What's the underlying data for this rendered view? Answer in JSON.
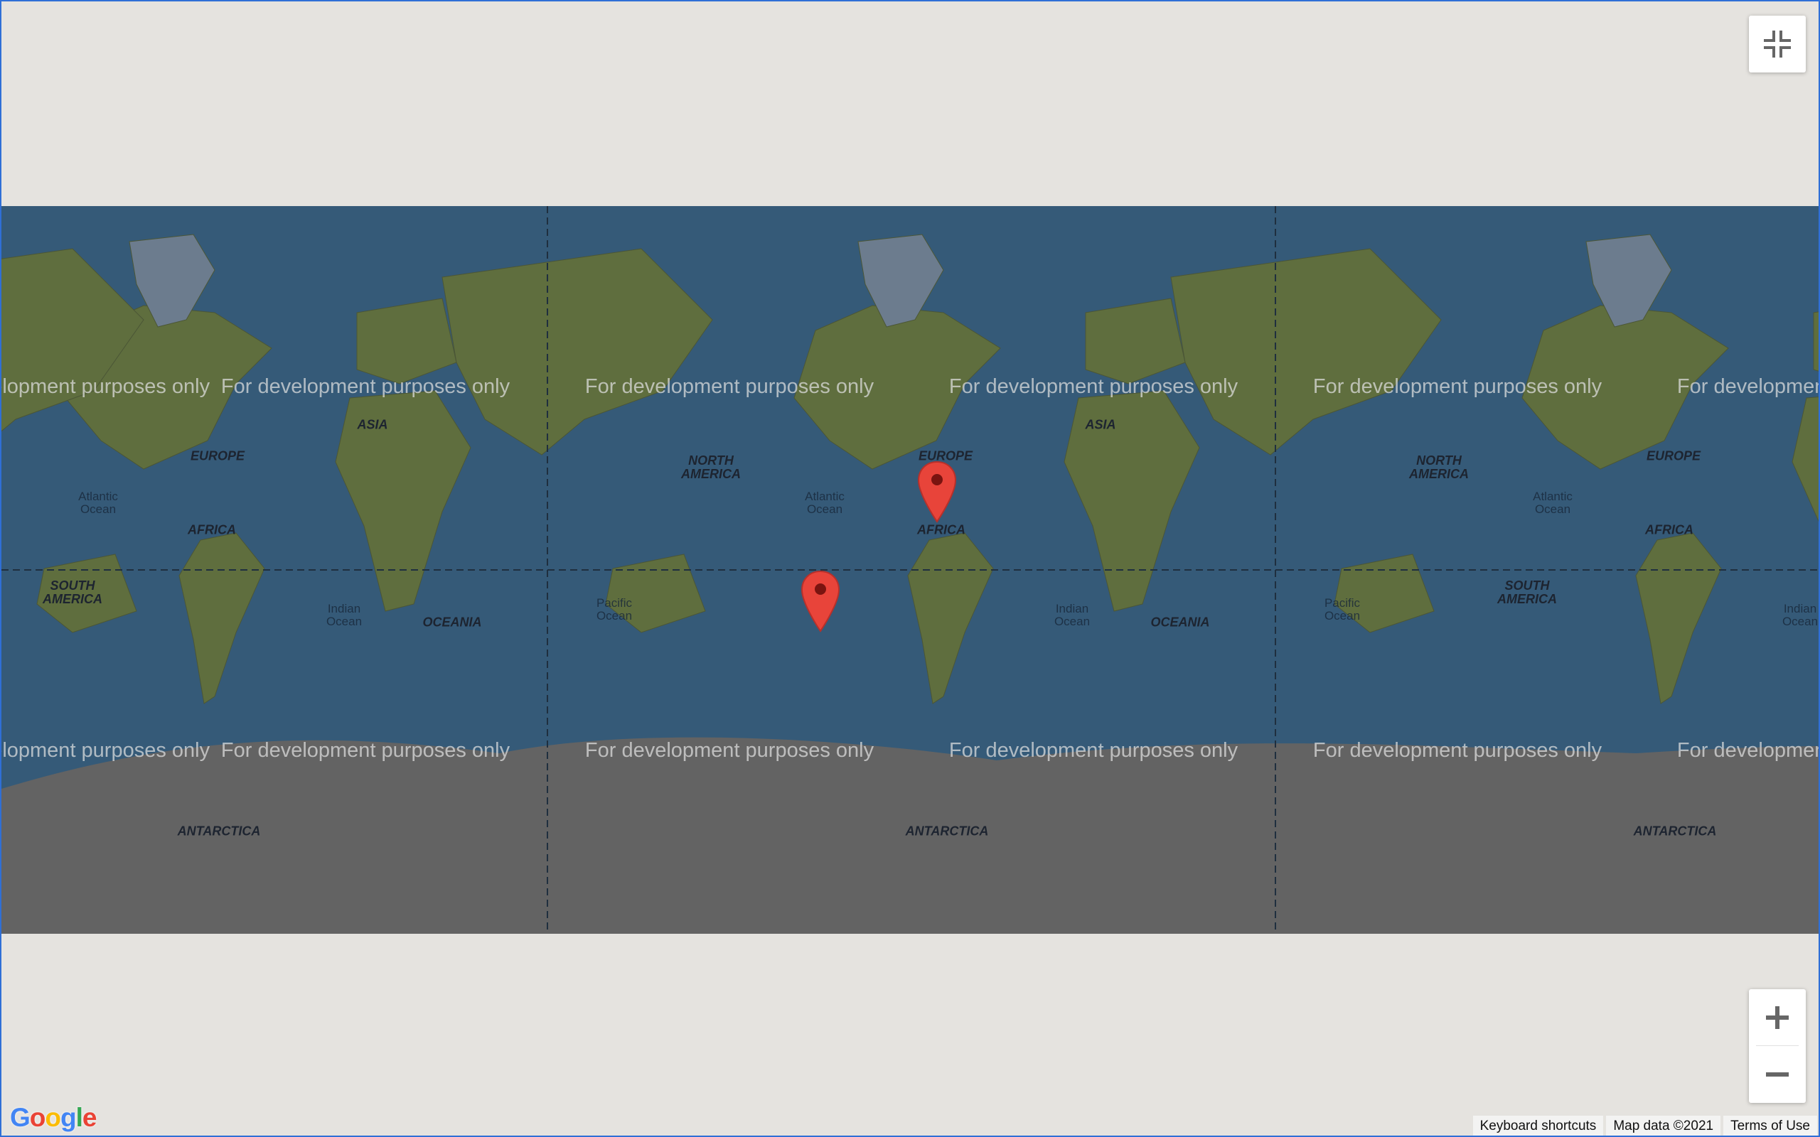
{
  "map": {
    "watermark": "For development purposes only",
    "continents": {
      "north_america": "NORTH\nAMERICA",
      "south_america": "SOUTH\nAMERICA",
      "europe": "EUROPE",
      "africa": "AFRICA",
      "asia": "ASIA",
      "oceania": "OCEANIA",
      "antarctica": "ANTARCTICA"
    },
    "oceans": {
      "atlantic": "Atlantic\nOcean",
      "pacific": "Pacific\nOcean",
      "indian": "Indian\nOcean"
    },
    "markers": [
      {
        "name": "marker-africa"
      },
      {
        "name": "marker-south-america"
      }
    ],
    "colors": {
      "water": "#355a78",
      "land": "#5f6e3e",
      "antarctica": "#636363",
      "marker": "#e8443a",
      "background": "#e5e3df"
    }
  },
  "controls": {
    "fullscreen_icon": "exit-fullscreen-icon",
    "zoom_in_icon": "plus-icon",
    "zoom_out_icon": "minus-icon"
  },
  "footer": {
    "logo": "Google",
    "keyboard_shortcuts": "Keyboard shortcuts",
    "map_data": "Map data ©2021",
    "terms": "Terms of Use"
  }
}
